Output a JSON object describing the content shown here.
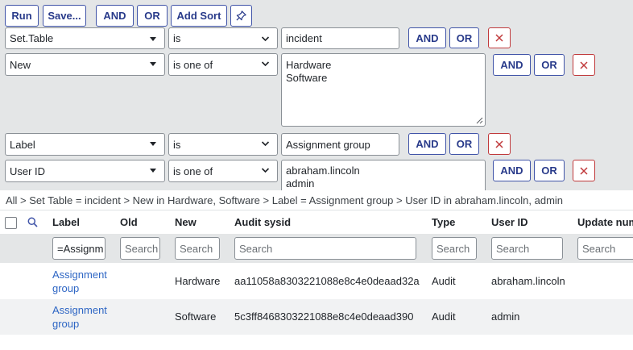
{
  "toolbar": {
    "run": "Run",
    "save": "Save...",
    "and": "AND",
    "or": "OR",
    "add_sort": "Add Sort"
  },
  "conditions": [
    {
      "field": "Set.Table",
      "operator": "is",
      "value": "incident",
      "and": "AND",
      "or": "OR"
    },
    {
      "field": "New",
      "operator": "is one of",
      "values": [
        "Hardware",
        "Software"
      ],
      "and": "AND",
      "or": "OR"
    },
    {
      "field": "Label",
      "operator": "is",
      "value": "Assignment group",
      "and": "AND",
      "or": "OR"
    },
    {
      "field": "User ID",
      "operator": "is one of",
      "values": [
        "abraham.lincoln",
        "admin"
      ],
      "and": "AND",
      "or": "OR"
    }
  ],
  "breadcrumb": "All > Set Table = incident > New in Hardware, Software > Label = Assignment group > User ID in abraham.lincoln, admin",
  "columns": [
    "Label",
    "Old",
    "New",
    "Audit sysid",
    "Type",
    "User ID",
    "Update num"
  ],
  "search": {
    "label_value": "=Assignm",
    "old_placeholder": "Search",
    "new_placeholder": "Search",
    "audit_placeholder": "Search",
    "type_placeholder": "Search",
    "userid_placeholder": "Search",
    "update_placeholder": "Search"
  },
  "rows": [
    {
      "label": "Assignment group",
      "old": "",
      "new": "Hardware",
      "audit_sysid": "aa11058a8303221088e8c4e0deaad32a",
      "type": "Audit",
      "user_id": "abraham.lincoln",
      "update_num": ""
    },
    {
      "label": "Assignment group",
      "old": "",
      "new": "Software",
      "audit_sysid": "5c3ff8468303221088e8c4e0deaad390",
      "type": "Audit",
      "user_id": "admin",
      "update_num": ""
    }
  ],
  "colors": {
    "accent": "#283a8a",
    "danger": "#c0393b",
    "link": "#2e66c4",
    "filter_bg": "#e4e6e7"
  }
}
